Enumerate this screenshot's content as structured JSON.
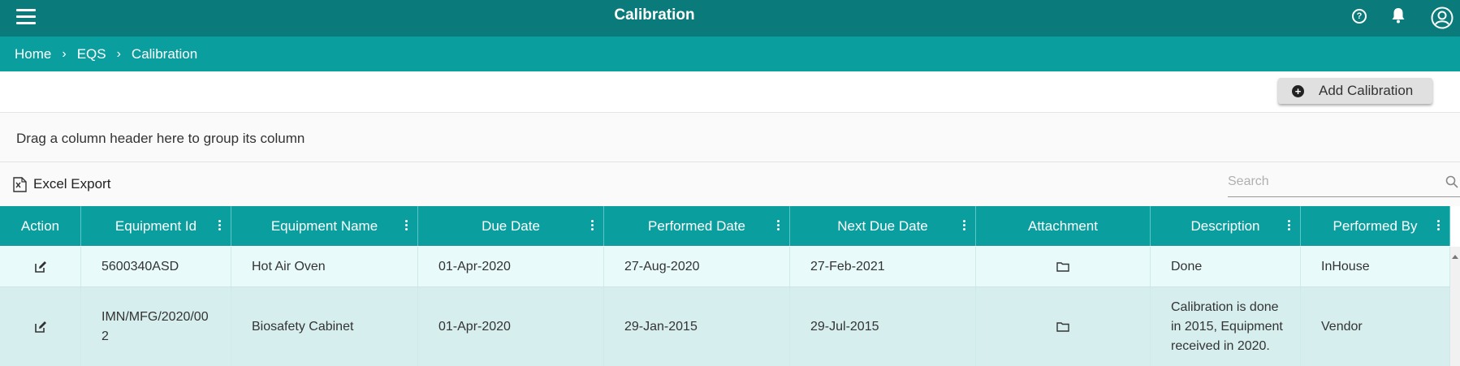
{
  "app": {
    "title": "Calibration"
  },
  "breadcrumb": [
    {
      "label": "Home"
    },
    {
      "label": "EQS"
    },
    {
      "label": "Calibration"
    }
  ],
  "actions": {
    "add_label": "Add Calibration"
  },
  "grid": {
    "group_hint": "Drag a column header here to group its column",
    "excel_label": "Excel Export",
    "search_placeholder": "Search",
    "columns": [
      {
        "label": "Action"
      },
      {
        "label": "Equipment Id"
      },
      {
        "label": "Equipment Name"
      },
      {
        "label": "Due Date"
      },
      {
        "label": "Performed Date"
      },
      {
        "label": "Next Due Date"
      },
      {
        "label": "Attachment"
      },
      {
        "label": "Description"
      },
      {
        "label": "Performed By"
      }
    ],
    "rows": [
      {
        "equipment_id": "5600340ASD",
        "equipment_name": "Hot Air Oven",
        "due_date": "01-Apr-2020",
        "performed_date": "27-Aug-2020",
        "next_due_date": "27-Feb-2021",
        "description": "Done",
        "performed_by": "InHouse"
      },
      {
        "equipment_id": "IMN/MFG/2020/002",
        "equipment_name": "Biosafety Cabinet",
        "due_date": "01-Apr-2020",
        "performed_date": "29-Jan-2015",
        "next_due_date": "29-Jul-2015",
        "description": "Calibration is done in 2015, Equipment received in 2020.",
        "performed_by": "Vendor"
      }
    ]
  },
  "colors": {
    "topbar": "#0a7a7a",
    "accent": "#0b9e9e",
    "row_light": "#e8fafa",
    "row_alt": "#d7eeee"
  },
  "icons": [
    "menu-icon",
    "help-icon",
    "bell-icon",
    "user-icon",
    "plus-circle-icon",
    "excel-icon",
    "search-icon",
    "kebab-icon",
    "edit-icon",
    "folder-icon"
  ]
}
